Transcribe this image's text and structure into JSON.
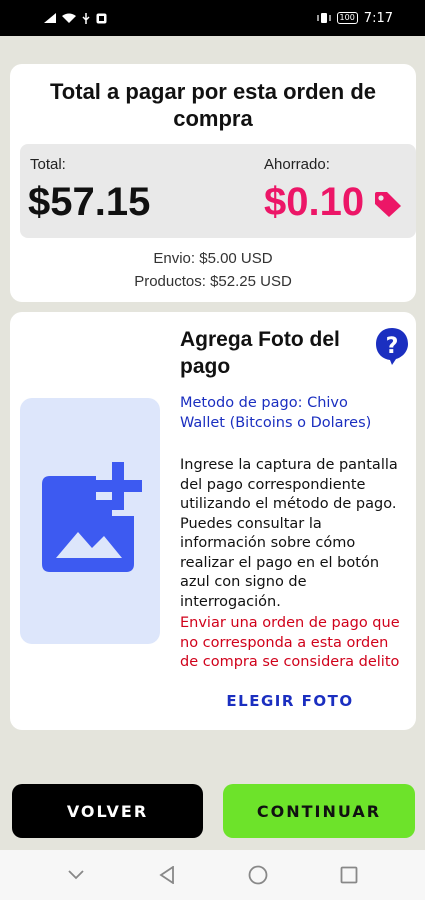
{
  "status_bar": {
    "time": "7:17",
    "battery": "100"
  },
  "summary": {
    "title": "Total a pagar por esta orden de compra",
    "total_label": "Total:",
    "total_value": "$57.15",
    "saved_label": "Ahorrado:",
    "saved_value": "$0.10",
    "shipping": "Envio: $5.00 USD",
    "products": "Productos: $52.25 USD"
  },
  "photo": {
    "title": "Agrega Foto del pago",
    "method": "Metodo de pago: Chivo Wallet (Bitcoins o Dolares)",
    "instructions": "Ingrese la captura de pantalla del pago correspondiente utilizando el método de pago. Puedes consultar la información sobre cómo realizar el pago en el botón azul con signo de interrogación.",
    "warning": "Enviar una orden de pago que no corresponda a esta orden de compra se considera delito",
    "choose_label": "ELEGIR FOTO"
  },
  "actions": {
    "back_label": "VOLVER",
    "continue_label": "CONTINUAR"
  },
  "colors": {
    "accent_pink": "#ec1667",
    "link_blue": "#1b2fc0",
    "continue_green": "#6de32a",
    "warning_red": "#d0021b",
    "icon_blue": "#3d5af1"
  },
  "icons": [
    "signal-icon",
    "wifi-icon",
    "usb-icon",
    "notification-icon",
    "vibrate-icon",
    "battery-icon",
    "tag-icon",
    "add-photo-icon",
    "help-icon",
    "chevron-down-icon",
    "back-icon",
    "home-icon",
    "recents-icon"
  ]
}
